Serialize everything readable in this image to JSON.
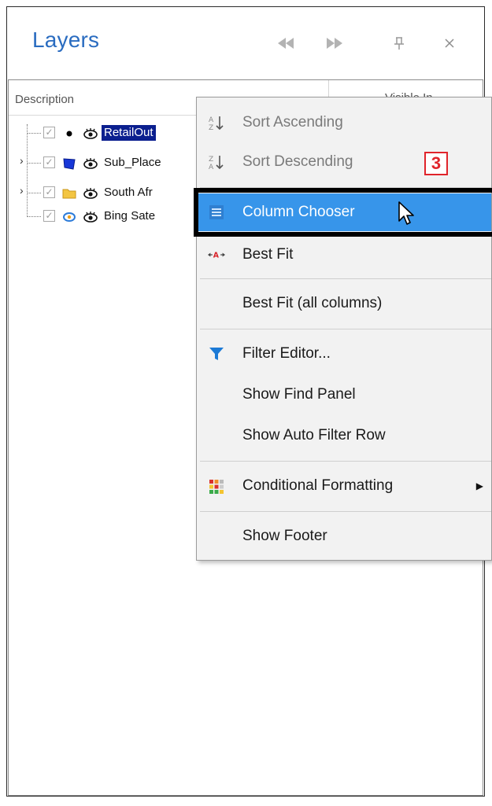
{
  "panel": {
    "title": "Layers",
    "buttons": {
      "prev": "◀◀",
      "next": "▶▶",
      "pin": "⊥",
      "close": "✕"
    }
  },
  "grid": {
    "columns": [
      {
        "label": "Description"
      },
      {
        "label": "Visible In..."
      }
    ],
    "rows": [
      {
        "name": "RetailOut",
        "icon": "dot-icon",
        "selected": true
      },
      {
        "name": "Sub_Place",
        "icon": "polygon-icon",
        "selected": false
      },
      {
        "name": "South Afr",
        "icon": "folder-icon",
        "selected": false
      },
      {
        "name": "Bing Sate",
        "icon": "bing-satellite-icon",
        "selected": false
      }
    ]
  },
  "context_menu": {
    "items": [
      {
        "label": "Sort Ascending",
        "icon": "sort-ascending-icon",
        "disabled": true
      },
      {
        "label": "Sort Descending",
        "icon": "sort-descending-icon",
        "disabled": true
      },
      {
        "label": "Column Chooser",
        "icon": "column-chooser-icon",
        "highlighted": true
      },
      {
        "label": "Best Fit",
        "icon": "best-fit-icon"
      },
      {
        "label": "Best Fit (all columns)"
      },
      {
        "label": "Filter Editor...",
        "icon": "filter-icon"
      },
      {
        "label": "Show Find Panel"
      },
      {
        "label": "Show Auto Filter Row"
      },
      {
        "label": "Conditional Formatting",
        "icon": "conditional-formatting-icon",
        "has_submenu": true
      },
      {
        "label": "Show Footer"
      }
    ]
  },
  "annotation": {
    "step_number": "3",
    "color": "#e0242b"
  },
  "colors": {
    "title": "#2a6cc0",
    "selection": "#0b1f8f",
    "menu_highlight": "#3795ea"
  }
}
